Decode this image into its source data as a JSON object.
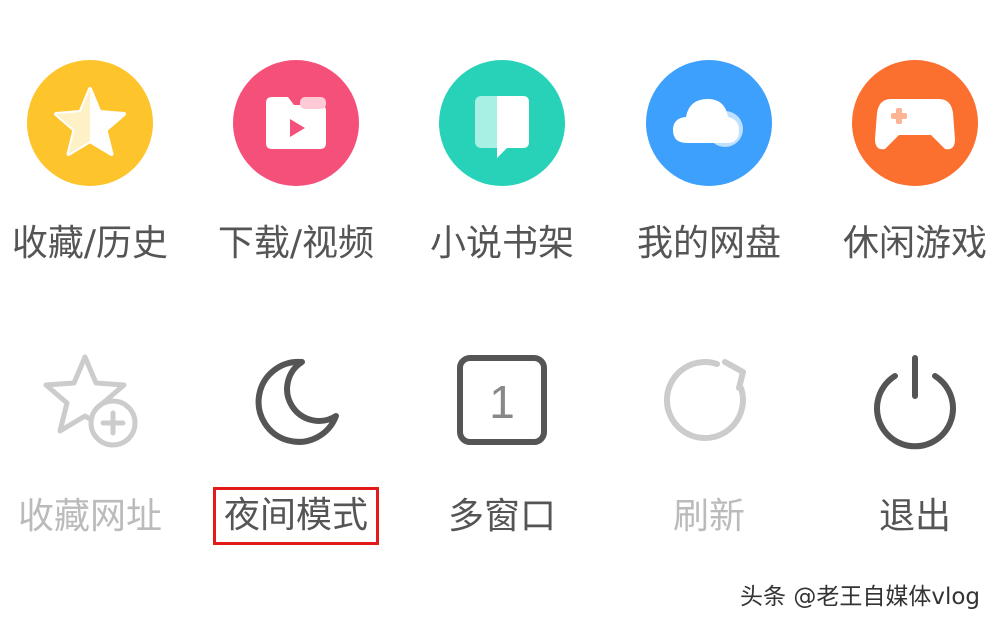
{
  "menu": {
    "row1": [
      {
        "label": "收藏/历史",
        "icon": "star-icon",
        "color": "#FDC42C"
      },
      {
        "label": "下载/视频",
        "icon": "video-folder-icon",
        "color": "#F5507A"
      },
      {
        "label": "小说书架",
        "icon": "book-icon",
        "color": "#27D2B9"
      },
      {
        "label": "我的网盘",
        "icon": "cloud-icon",
        "color": "#3DA0FC"
      },
      {
        "label": "休闲游戏",
        "icon": "gamepad-icon",
        "color": "#FB6F2F"
      }
    ],
    "row2": [
      {
        "label": "收藏网址",
        "icon": "star-add-icon",
        "state": "disabled"
      },
      {
        "label": "夜间模式",
        "icon": "moon-icon",
        "state": "enabled",
        "highlighted": true,
        "highlight_color": "#E21A1A"
      },
      {
        "label": "多窗口",
        "icon": "window-count-icon",
        "state": "enabled",
        "count": "1"
      },
      {
        "label": "刷新",
        "icon": "refresh-icon",
        "state": "disabled"
      },
      {
        "label": "退出",
        "icon": "power-icon",
        "state": "enabled"
      }
    ]
  },
  "watermark": "头条 @老王自媒体vlog"
}
